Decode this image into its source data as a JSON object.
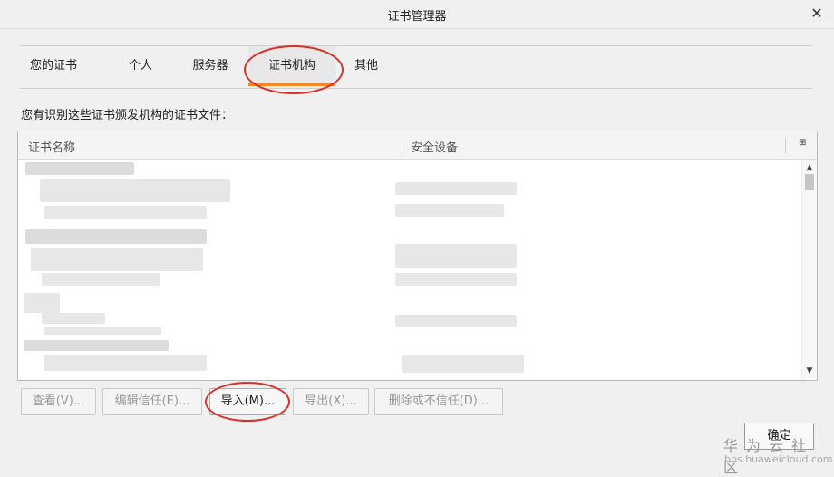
{
  "window": {
    "title": "证书管理器",
    "close_symbol": "✕"
  },
  "tabs": [
    {
      "label": "您的证书"
    },
    {
      "label": "个人"
    },
    {
      "label": "服务器"
    },
    {
      "label": "证书机构"
    },
    {
      "label": "其他"
    }
  ],
  "active_tab": "证书机构",
  "description": "您有识别这些证书颁发机构的证书文件：",
  "table": {
    "columns": [
      "证书名称",
      "安全设备"
    ],
    "column_picker_symbol": "⊞",
    "scroll_up": "▲",
    "scroll_down": "▼"
  },
  "buttons": {
    "view": "查看(V)...",
    "edit_trust": "编辑信任(E)...",
    "import": "导入(M)...",
    "export": "导出(X)...",
    "delete": "删除或不信任(D)...",
    "ok": "确定"
  },
  "watermark": {
    "line1": "华为云社区",
    "line2": "bbs.huaweicloud.com"
  },
  "colors": {
    "active_tab_underline": "#f08a24",
    "annotation_circle": "#d9302a"
  }
}
